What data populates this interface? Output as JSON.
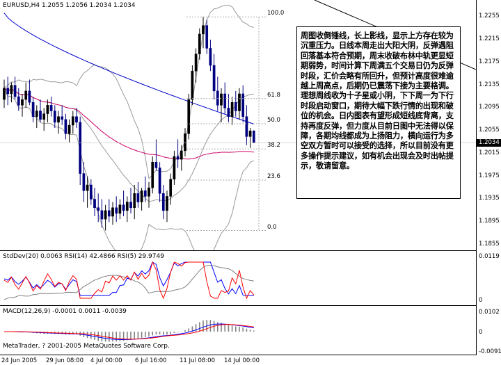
{
  "main": {
    "title": "EURUSD,H4  1.2055 1.2056 1.2034 1.2034",
    "price_axis": [
      "1.2255",
      "1.2215",
      "1.2175",
      "1.2135",
      "1.2095",
      "1.2055",
      "1.2015",
      "1.1975",
      "1.1935",
      "1.1895",
      "1.1855"
    ],
    "current_price": "1.2034",
    "fib_levels": [
      "100.0",
      "61.8",
      "50.0",
      "38.2",
      "23.6",
      "0.0"
    ],
    "comment": "周图收倒锤线，长上影线，显示上方存在较为沉重压力。日线本周走出大阳大阴，反弹遇阻回落基本符合预期，周末收破布林中轨更显短期弱势，时间计算下周满五个交易日仍为反弹时段，汇价会略有所回升，但预计高度很难逾越上周高点，后期仍已震荡下接为主要格调。理想周线收为十子星或小阴，下下周一为下行时段启动窗口，期待大幅下跌行情的出现和破位的机会。日内图表有望形成短线底背离，支持再度反弹，但力度从目前日图中无法得以保障，各期均线都成为上扬阻力，横向运行为多空双方暂时可以接受的选择，所以目前没有更多操作提示建议，如有机会出现会及时出帖提示，敬请留意。"
  },
  "indicators": {
    "title": "StdDev(20) 0.0063  RSI(14) 42.4866  RSI(5) 29.9749",
    "axis": [
      "0.0119",
      "0"
    ]
  },
  "macd": {
    "title": "MACD(12,26,9) -0.0001 0.0011 -0.0039",
    "axis": [
      "0.0102",
      "0",
      "-0.0091"
    ]
  },
  "copyright": "MetaTrader, ? 2001-2005 MetaQuotes Software Corp.",
  "time_axis": [
    "24 Jun 2005",
    "29 Jun 08:00",
    "4 Jul 00:00",
    "6 Jul 16:00",
    "11 Jul 08:00",
    "14 Jul 00:00"
  ],
  "colors": {
    "up_candle": "#000000",
    "down_candle": "#000080",
    "ma_blue": "#0000cc",
    "ma_red": "#cc0066",
    "bollinger": "#999999",
    "rsi_red": "#ff0000",
    "rsi_blue": "#0000ff",
    "stddev": "#808080"
  },
  "chart_data": {
    "type": "candlestick",
    "symbol": "EURUSD",
    "timeframe": "H4",
    "ylim": [
      1.1855,
      1.2275
    ],
    "candles": [
      [
        1.211,
        1.2145,
        1.2095,
        1.213
      ],
      [
        1.213,
        1.215,
        1.21,
        1.212
      ],
      [
        1.212,
        1.214,
        1.2105,
        1.2135
      ],
      [
        1.2135,
        1.215,
        1.211,
        1.2115
      ],
      [
        1.2115,
        1.213,
        1.209,
        1.21
      ],
      [
        1.21,
        1.212,
        1.208,
        1.211
      ],
      [
        1.211,
        1.214,
        1.2095,
        1.2125
      ],
      [
        1.2125,
        1.2145,
        1.21,
        1.2105
      ],
      [
        1.2105,
        1.2115,
        1.207,
        1.208
      ],
      [
        1.208,
        1.21,
        1.206,
        1.209
      ],
      [
        1.209,
        1.211,
        1.207,
        1.2075
      ],
      [
        1.2075,
        1.2095,
        1.2055,
        1.2085
      ],
      [
        1.2085,
        1.211,
        1.207,
        1.21
      ],
      [
        1.21,
        1.2115,
        1.208,
        1.209
      ],
      [
        1.209,
        1.21,
        1.206,
        1.207
      ],
      [
        1.207,
        1.209,
        1.205,
        1.208
      ],
      [
        1.208,
        1.21,
        1.2065,
        1.2075
      ],
      [
        1.2075,
        1.2085,
        1.204,
        1.205
      ],
      [
        1.205,
        1.2075,
        1.2035,
        1.2065
      ],
      [
        1.2065,
        1.209,
        1.205,
        1.208
      ],
      [
        1.208,
        1.2095,
        1.206,
        1.207
      ],
      [
        1.207,
        1.208,
        1.196,
        1.198
      ],
      [
        1.198,
        1.2,
        1.193,
        1.195
      ],
      [
        1.195,
        1.1975,
        1.192,
        1.196
      ],
      [
        1.196,
        1.197,
        1.1925,
        1.1935
      ],
      [
        1.1935,
        1.1955,
        1.1905,
        1.192
      ],
      [
        1.192,
        1.1945,
        1.1895,
        1.1915
      ],
      [
        1.1915,
        1.1935,
        1.1885,
        1.19
      ],
      [
        1.19,
        1.1925,
        1.188,
        1.1915
      ],
      [
        1.1915,
        1.1935,
        1.1895,
        1.1905
      ],
      [
        1.1905,
        1.193,
        1.189,
        1.192
      ],
      [
        1.192,
        1.194,
        1.1895,
        1.191
      ],
      [
        1.191,
        1.1935,
        1.19,
        1.1925
      ],
      [
        1.1925,
        1.195,
        1.1905,
        1.1915
      ],
      [
        1.1915,
        1.194,
        1.1895,
        1.193
      ],
      [
        1.193,
        1.1955,
        1.191,
        1.192
      ],
      [
        1.192,
        1.196,
        1.19,
        1.1945
      ],
      [
        1.1945,
        1.1965,
        1.192,
        1.193
      ],
      [
        1.193,
        1.1955,
        1.1915,
        1.195
      ],
      [
        1.195,
        1.1975,
        1.193,
        1.194
      ],
      [
        1.194,
        1.1965,
        1.192,
        1.1955
      ],
      [
        1.1955,
        1.201,
        1.1945,
        1.2
      ],
      [
        1.2,
        1.204,
        1.1985,
        1.199
      ],
      [
        1.199,
        1.2,
        1.193,
        1.1945
      ],
      [
        1.1945,
        1.196,
        1.19,
        1.1915
      ],
      [
        1.1915,
        1.195,
        1.1895,
        1.194
      ],
      [
        1.194,
        1.198,
        1.1925,
        1.197
      ],
      [
        1.197,
        1.202,
        1.196,
        1.201
      ],
      [
        1.201,
        1.204,
        1.199,
        1.2005
      ],
      [
        1.2005,
        1.203,
        1.1985,
        1.202
      ],
      [
        1.202,
        1.206,
        1.201,
        1.205
      ],
      [
        1.205,
        1.212,
        1.204,
        1.211
      ],
      [
        1.211,
        1.217,
        1.21,
        1.216
      ],
      [
        1.216,
        1.22,
        1.214,
        1.219
      ],
      [
        1.219,
        1.2235,
        1.218,
        1.2225
      ],
      [
        1.2225,
        1.2255,
        1.22,
        1.224
      ],
      [
        1.224,
        1.225,
        1.219,
        1.22
      ],
      [
        1.22,
        1.2215,
        1.216,
        1.217
      ],
      [
        1.217,
        1.219,
        1.211,
        1.2125
      ],
      [
        1.2125,
        1.215,
        1.209,
        1.21
      ],
      [
        1.21,
        1.213,
        1.207,
        1.212
      ],
      [
        1.212,
        1.214,
        1.2085,
        1.2095
      ],
      [
        1.2095,
        1.212,
        1.207,
        1.208
      ],
      [
        1.208,
        1.2115,
        1.2065,
        1.2105
      ],
      [
        1.2105,
        1.2125,
        1.208,
        1.209
      ],
      [
        1.209,
        1.213,
        1.2075,
        1.212
      ],
      [
        1.212,
        1.2135,
        1.207,
        1.208
      ],
      [
        1.208,
        1.21,
        1.203,
        1.2045
      ],
      [
        1.2045,
        1.206,
        1.2025,
        1.2055
      ],
      [
        1.2055,
        1.2056,
        1.2034,
        1.2034
      ]
    ]
  }
}
